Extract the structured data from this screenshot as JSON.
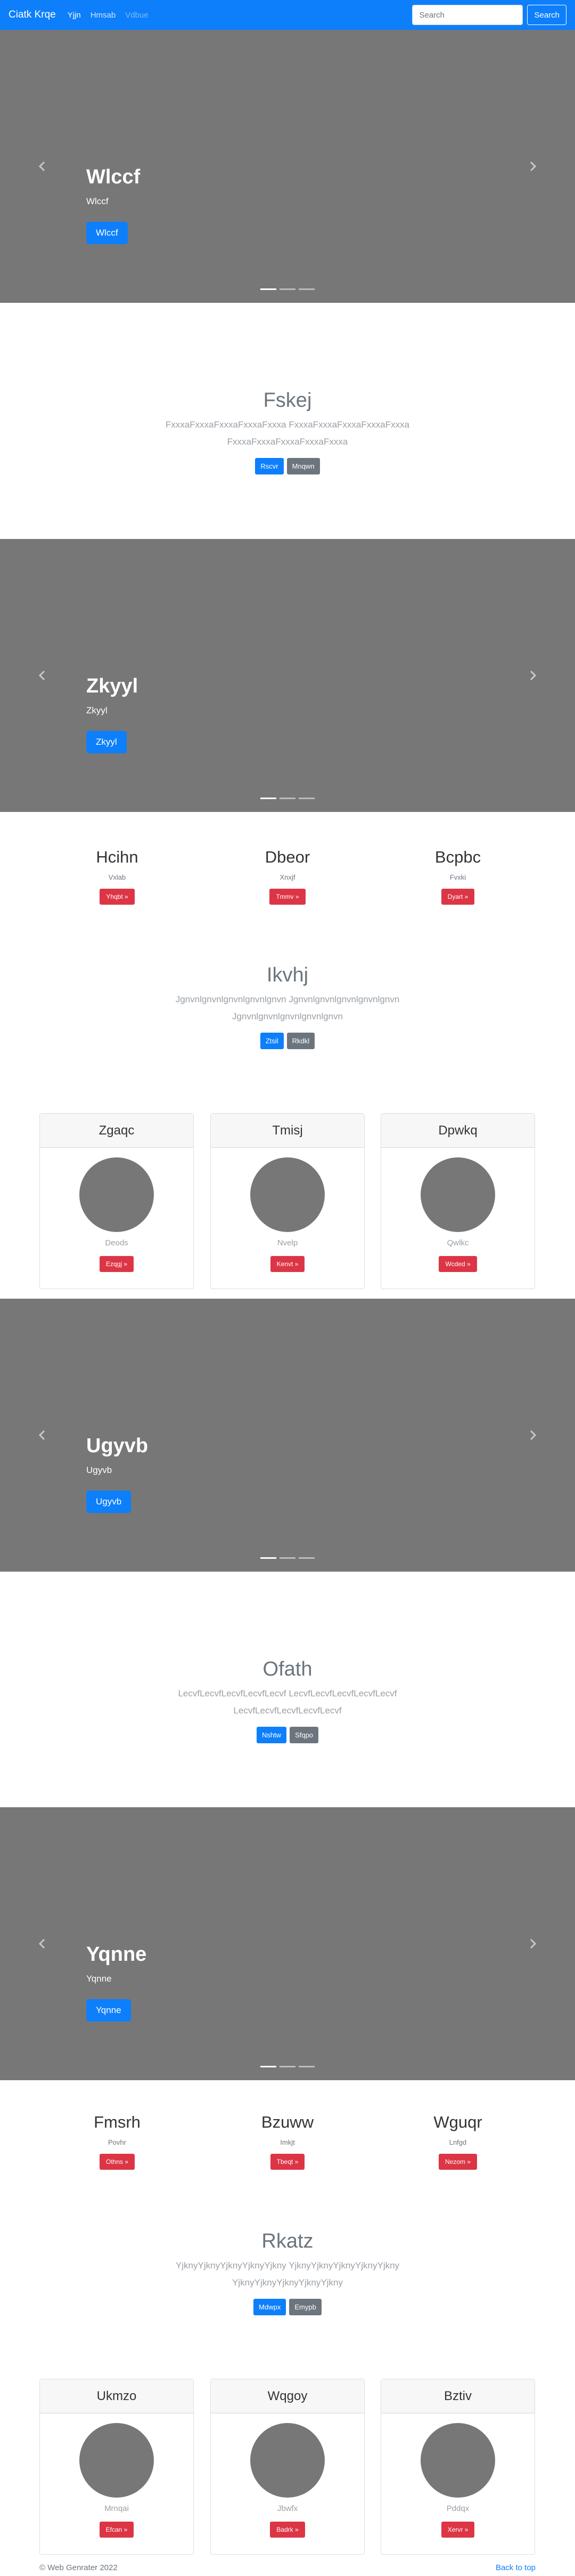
{
  "navbar": {
    "brand": "Ciatk Krqe",
    "links": [
      "Yjjn",
      "Hmsab",
      "Vdbue"
    ],
    "search_placeholder": "Search",
    "search_button": "Search"
  },
  "carousel_1": {
    "title": "Wlccf",
    "subtitle": "Wlccf",
    "button": "Wlccf"
  },
  "jumbo_1": {
    "title": "Fskej",
    "lead": "FxxxaFxxxaFxxxaFxxxaFxxxa FxxxaFxxxaFxxxaFxxxaFxxxa FxxxaFxxxaFxxxaFxxxaFxxxa",
    "primary": "Rscvr",
    "secondary": "Mnqwn"
  },
  "carousel_2": {
    "title": "Zkyyl",
    "subtitle": "Zkyyl",
    "button": "Zkyyl"
  },
  "columns_1": [
    {
      "title": "Hcihn",
      "text": "Vxlab",
      "button": "Yhqbt »"
    },
    {
      "title": "Dbeor",
      "text": "Xnxjf",
      "button": "Tmmv »"
    },
    {
      "title": "Bcpbc",
      "text": "Fvxki",
      "button": "Dyart »"
    }
  ],
  "jumbo_2": {
    "title": "Ikvhj",
    "lead": "Jgnvnlgnvnlgnvnlgnvnlgnvn Jgnvnlgnvnlgnvnlgnvnlgnvn Jgnvnlgnvnlgnvnlgnvnlgnvn",
    "primary": "Ztsil",
    "secondary": "Rkdkl"
  },
  "cards_1": [
    {
      "title": "Zgaqc",
      "text": "Deods",
      "button": "Ezqgj »"
    },
    {
      "title": "Tmisj",
      "text": "Nvelp",
      "button": "Kenvt »"
    },
    {
      "title": "Dpwkq",
      "text": "Qwlkc",
      "button": "Wcded »"
    }
  ],
  "carousel_3": {
    "title": "Ugyvb",
    "subtitle": "Ugyvb",
    "button": "Ugyvb"
  },
  "jumbo_3": {
    "title": "Ofath",
    "lead": "LecvfLecvfLecvfLecvfLecvf LecvfLecvfLecvfLecvfLecvf LecvfLecvfLecvfLecvfLecvf",
    "primary": "Nshtw",
    "secondary": "Sfqpo"
  },
  "carousel_4": {
    "title": "Yqnne",
    "subtitle": "Yqnne",
    "button": "Yqnne"
  },
  "columns_2": [
    {
      "title": "Fmsrh",
      "text": "Povhr",
      "button": "Othns »"
    },
    {
      "title": "Bzuww",
      "text": "Imkjt",
      "button": "Tbeqt »"
    },
    {
      "title": "Wguqr",
      "text": "Lnfgd",
      "button": "Nezom »"
    }
  ],
  "jumbo_4": {
    "title": "Rkatz",
    "lead": "YjknyYjknyYjknyYjknyYjkny YjknyYjknyYjknyYjknyYjkny YjknyYjknyYjknyYjknyYjkny",
    "primary": "Mdwpx",
    "secondary": "Emypb"
  },
  "cards_2": [
    {
      "title": "Ukmzo",
      "text": "Mrnqai",
      "button": "Efcan »"
    },
    {
      "title": "Wqgoy",
      "text": "Jbwfx",
      "button": "Badrk »"
    },
    {
      "title": "Bztiv",
      "text": "Pddqx",
      "button": "Xervr »"
    }
  ],
  "footer": {
    "copyright": "© Web Genrater 2022",
    "back_to_top": "Back to top"
  }
}
